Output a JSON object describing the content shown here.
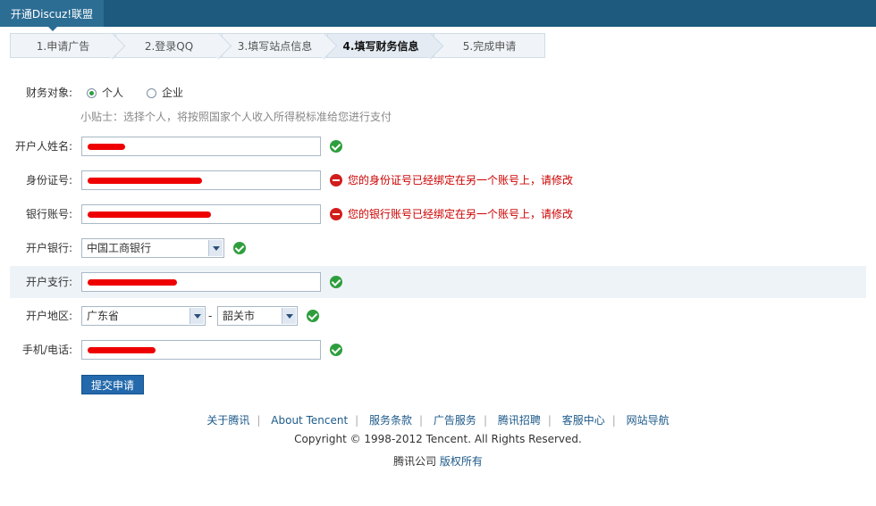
{
  "header": {
    "tab_label": "开通Discuz!联盟"
  },
  "steps": [
    {
      "label": "1.申请广告",
      "active": false
    },
    {
      "label": "2.登录QQ",
      "active": false
    },
    {
      "label": "3.填写站点信息",
      "active": false
    },
    {
      "label": "4.填写财务信息",
      "active": true
    },
    {
      "label": "5.完成申请",
      "active": false
    }
  ],
  "form": {
    "finance_target": {
      "label": "财务对象:",
      "options": [
        {
          "label": "个人",
          "selected": true
        },
        {
          "label": "企业",
          "selected": false
        }
      ],
      "tip": "小贴士：选择个人，将按照国家个人收入所得税标准给您进行支付"
    },
    "account_name": {
      "label": "开户人姓名:",
      "value": "",
      "status": "ok"
    },
    "id_number": {
      "label": "身份证号:",
      "value": "",
      "status": "error",
      "error": "您的身份证号已经绑定在另一个账号上，请修改"
    },
    "bank_account": {
      "label": "银行账号:",
      "value": "",
      "status": "error",
      "error": "您的银行账号已经绑定在另一个账号上，请修改"
    },
    "bank": {
      "label": "开户银行:",
      "value": "中国工商银行",
      "status": "ok"
    },
    "branch": {
      "label": "开户支行:",
      "value": "",
      "status": "ok"
    },
    "region": {
      "label": "开户地区:",
      "province": "广东省",
      "separator": "-",
      "city": "韶关市",
      "status": "ok"
    },
    "phone": {
      "label": "手机/电话:",
      "value": "",
      "status": "ok"
    },
    "submit_label": "提交申请"
  },
  "footer": {
    "links": [
      "关于腾讯",
      "About Tencent",
      "服务条款",
      "广告服务",
      "腾讯招聘",
      "客服中心",
      "网站导航"
    ],
    "copyright": "Copyright © 1998-2012 Tencent. All Rights Reserved.",
    "company": "腾讯公司",
    "company_link": "版权所有"
  },
  "colors": {
    "header_bg": "#1d5a7e",
    "ok": "#2e9e3d",
    "error": "#d21d1d",
    "button": "#2369ac"
  }
}
